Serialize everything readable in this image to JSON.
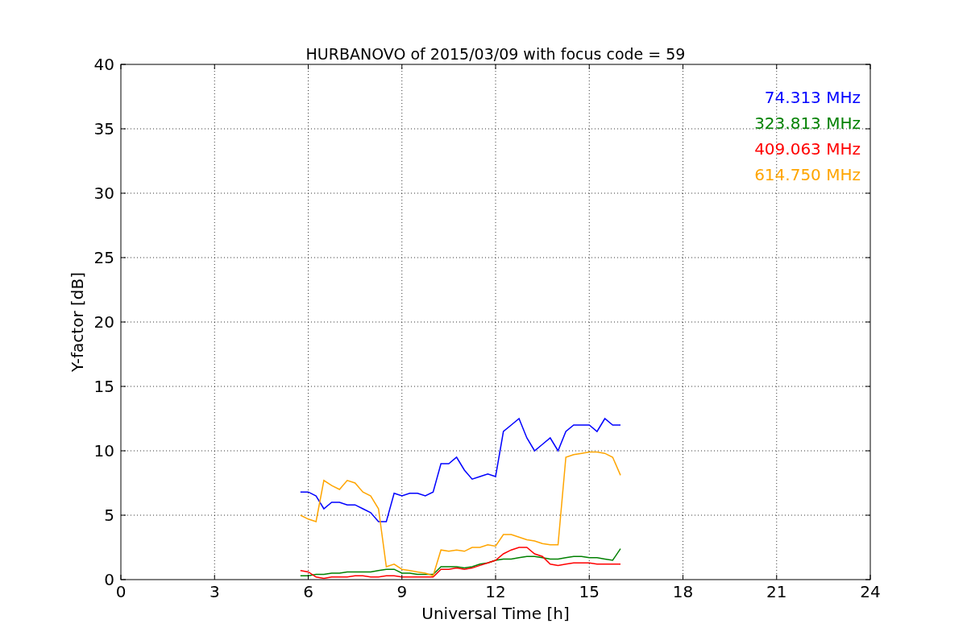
{
  "chart_data": {
    "type": "line",
    "title": "HURBANOVO of 2015/03/09 with focus code = 59",
    "xlabel": "Universal Time [h]",
    "ylabel": "Y-factor [dB]",
    "x": [
      5.75,
      6.0,
      6.25,
      6.5,
      6.75,
      7.0,
      7.25,
      7.5,
      7.75,
      8.0,
      8.25,
      8.5,
      8.75,
      9.0,
      9.25,
      9.5,
      9.75,
      10.0,
      10.25,
      10.5,
      10.75,
      11.0,
      11.25,
      11.5,
      11.75,
      12.0,
      12.25,
      12.5,
      12.75,
      13.0,
      13.25,
      13.5,
      13.75,
      14.0,
      14.25,
      14.5,
      14.75,
      15.0,
      15.25,
      15.5,
      15.75,
      16.0
    ],
    "series": [
      {
        "name": "74.313 MHz",
        "color": "#0000ff",
        "values": [
          6.8,
          6.8,
          6.5,
          5.5,
          6.0,
          6.0,
          5.8,
          5.8,
          5.5,
          5.2,
          4.5,
          4.5,
          6.7,
          6.5,
          6.7,
          6.7,
          6.5,
          6.8,
          9.0,
          9.0,
          9.5,
          8.5,
          7.8,
          8.0,
          8.2,
          8.0,
          11.5,
          12.0,
          12.5,
          11.0,
          10.0,
          10.5,
          11.0,
          10.0,
          11.5,
          12.0,
          12.0,
          12.0,
          11.5,
          12.5,
          12.0,
          12.0
        ]
      },
      {
        "name": "323.813 MHz",
        "color": "#008000",
        "values": [
          0.3,
          0.3,
          0.4,
          0.4,
          0.5,
          0.5,
          0.6,
          0.6,
          0.6,
          0.6,
          0.7,
          0.8,
          0.8,
          0.5,
          0.5,
          0.4,
          0.4,
          0.4,
          1.0,
          1.0,
          1.0,
          0.9,
          1.0,
          1.2,
          1.3,
          1.5,
          1.6,
          1.6,
          1.7,
          1.8,
          1.8,
          1.7,
          1.6,
          1.6,
          1.7,
          1.8,
          1.8,
          1.7,
          1.7,
          1.6,
          1.5,
          2.4
        ]
      },
      {
        "name": "409.063 MHz",
        "color": "#ff0000",
        "values": [
          0.7,
          0.6,
          0.2,
          0.1,
          0.2,
          0.2,
          0.2,
          0.3,
          0.3,
          0.2,
          0.2,
          0.3,
          0.3,
          0.2,
          0.2,
          0.2,
          0.2,
          0.2,
          0.8,
          0.8,
          0.9,
          0.8,
          0.9,
          1.1,
          1.3,
          1.5,
          2.0,
          2.3,
          2.5,
          2.5,
          2.0,
          1.8,
          1.2,
          1.1,
          1.2,
          1.3,
          1.3,
          1.3,
          1.2,
          1.2,
          1.2,
          1.2
        ]
      },
      {
        "name": "614.750 MHz",
        "color": "#ffa500",
        "values": [
          5.0,
          4.7,
          4.5,
          7.7,
          7.3,
          7.0,
          7.7,
          7.5,
          6.8,
          6.5,
          5.5,
          1.0,
          1.2,
          0.8,
          0.7,
          0.6,
          0.5,
          0.3,
          2.3,
          2.2,
          2.3,
          2.2,
          2.5,
          2.5,
          2.7,
          2.6,
          3.5,
          3.5,
          3.3,
          3.1,
          3.0,
          2.8,
          2.7,
          2.7,
          9.5,
          9.7,
          9.8,
          9.9,
          9.9,
          9.8,
          9.5,
          8.1
        ]
      }
    ],
    "grid": true,
    "xlim": [
      0,
      24
    ],
    "ylim": [
      0,
      40
    ],
    "xticks": [
      0,
      3,
      6,
      9,
      12,
      15,
      18,
      21,
      24
    ],
    "yticks": [
      0,
      5,
      10,
      15,
      20,
      25,
      30,
      35,
      40
    ]
  }
}
